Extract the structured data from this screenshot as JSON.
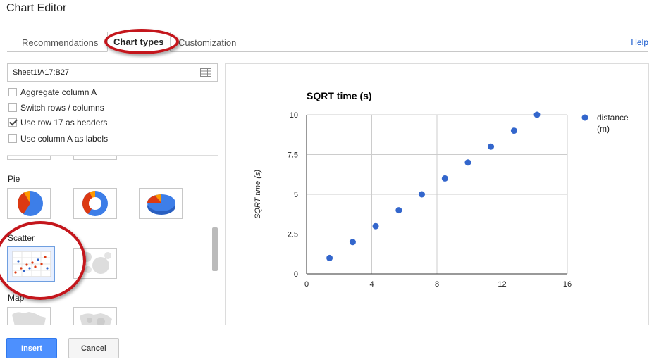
{
  "window": {
    "title": "Chart Editor"
  },
  "tabs": [
    {
      "label": "Recommendations"
    },
    {
      "label": "Chart types",
      "active": true
    },
    {
      "label": "Customization"
    }
  ],
  "help_label": "Help",
  "data_range": {
    "value": "Sheet1!A17:B27"
  },
  "options": [
    {
      "label": "Aggregate column A",
      "checked": false
    },
    {
      "label": "Switch rows / columns",
      "checked": false
    },
    {
      "label": "Use row 17 as headers",
      "checked": true
    },
    {
      "label": "Use column A as labels",
      "checked": false
    }
  ],
  "chart_groups": [
    {
      "label": "Pie"
    },
    {
      "label": "Scatter"
    },
    {
      "label": "Map"
    }
  ],
  "colors": {
    "series": "#3366cc",
    "accent_blue": "#4d90fe",
    "annotation_red": "#c4161c"
  },
  "buttons": {
    "insert": "Insert",
    "cancel": "Cancel"
  },
  "chart_data": {
    "type": "scatter",
    "title": "SQRT time (s)",
    "xlabel": "",
    "ylabel": "SQRT time (s)",
    "xlim": [
      0,
      16
    ],
    "ylim": [
      0,
      10
    ],
    "xticks": [
      "0",
      "4",
      "8",
      "12",
      "16"
    ],
    "yticks": [
      "0",
      "2.5",
      "5",
      "7.5",
      "10"
    ],
    "legend_position": "right",
    "grid": true,
    "series": [
      {
        "name": "distance (m)",
        "name_lines": [
          "distance",
          "(m)"
        ],
        "color": "#3366cc",
        "points": [
          [
            1.41,
            1
          ],
          [
            2.83,
            2
          ],
          [
            4.24,
            3
          ],
          [
            5.66,
            4
          ],
          [
            7.07,
            5
          ],
          [
            8.49,
            6
          ],
          [
            9.9,
            7
          ],
          [
            11.31,
            8
          ],
          [
            12.73,
            9
          ],
          [
            14.14,
            10
          ]
        ]
      }
    ]
  }
}
